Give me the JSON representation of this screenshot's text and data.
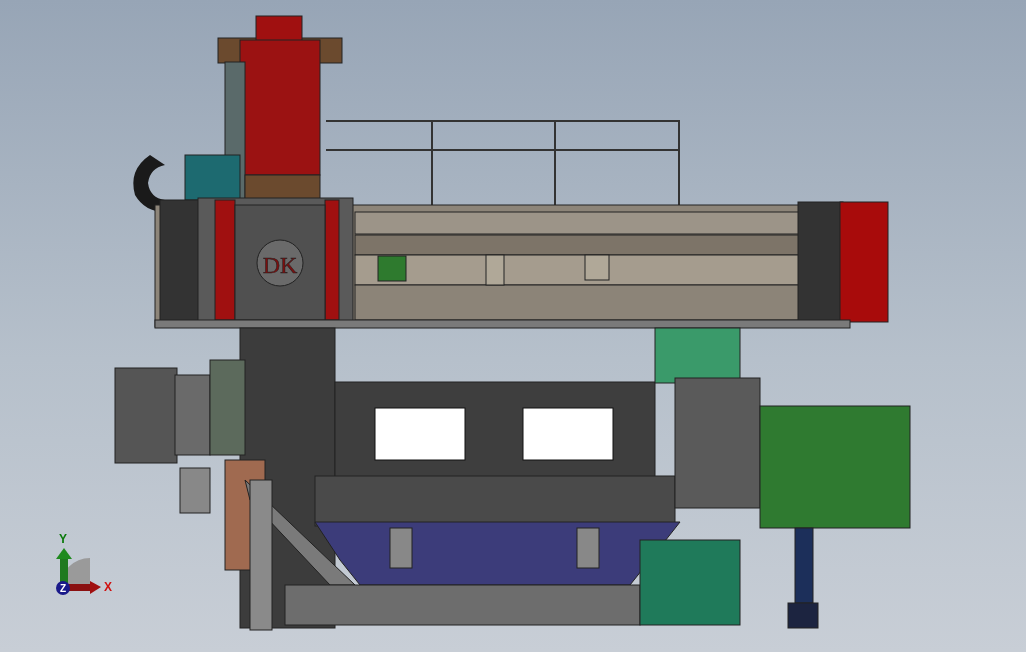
{
  "viewport": {
    "logo_text": "DK",
    "triad": {
      "x_label": "X",
      "y_label": "Y",
      "z_label": "Z"
    }
  }
}
